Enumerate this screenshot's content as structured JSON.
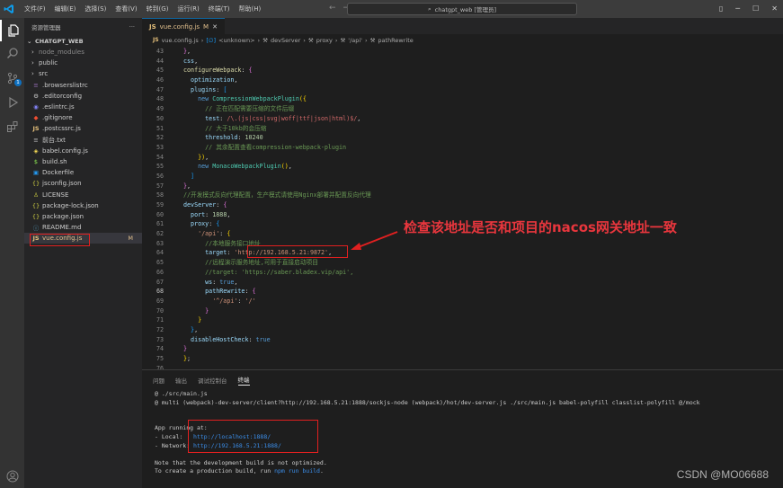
{
  "titlebar": {
    "menu": [
      "文件(F)",
      "编辑(E)",
      "选择(S)",
      "查看(V)",
      "转到(G)",
      "运行(R)",
      "终端(T)",
      "帮助(H)"
    ],
    "search_text": "chatgpt_web [管理员]"
  },
  "activity": {
    "icons": [
      "explorer-icon",
      "search-icon",
      "source-control-icon",
      "run-debug-icon",
      "extensions-icon",
      "account-icon"
    ],
    "scm_badge": "1"
  },
  "sidebar": {
    "header": "资源管理器",
    "project": "CHATGPT_WEB",
    "items": [
      {
        "label": "node_modules",
        "type": "folder"
      },
      {
        "label": "public",
        "type": "folder"
      },
      {
        "label": "src",
        "type": "folder"
      },
      {
        "label": ".browserslistrc",
        "type": "file"
      },
      {
        "label": ".editorconfig",
        "type": "file"
      },
      {
        "label": ".eslintrc.js",
        "type": "file"
      },
      {
        "label": ".gitignore",
        "type": "file"
      },
      {
        "label": ".postcssrc.js",
        "type": "file"
      },
      {
        "label": "前台.txt",
        "type": "file"
      },
      {
        "label": "babel.config.js",
        "type": "file"
      },
      {
        "label": "build.sh",
        "type": "file"
      },
      {
        "label": "Dockerfile",
        "type": "file"
      },
      {
        "label": "jsconfig.json",
        "type": "file"
      },
      {
        "label": "LICENSE",
        "type": "file"
      },
      {
        "label": "package-lock.json",
        "type": "file"
      },
      {
        "label": "package.json",
        "type": "file"
      },
      {
        "label": "README.md",
        "type": "file"
      },
      {
        "label": "vue.config.js",
        "type": "file",
        "status": "M"
      }
    ]
  },
  "editor": {
    "tab_label": "vue.config.js",
    "tab_status": "M",
    "breadcrumb": [
      "vue.config.js",
      "<unknown>",
      "devServer",
      "proxy",
      "'/api'",
      "pathRewrite"
    ],
    "line_numbers": [
      "43",
      "44",
      "45",
      "46",
      "47",
      "48",
      "49",
      "50",
      "51",
      "52",
      "53",
      "54",
      "55",
      "56",
      "57",
      "58",
      "59",
      "60",
      "61",
      "62",
      "63",
      "64",
      "65",
      "66",
      "67",
      "68",
      "69",
      "70",
      "71",
      "72",
      "73",
      "74",
      "75",
      "76"
    ],
    "current_line": "68"
  },
  "annotation": {
    "text": "检查该地址是否和项目的nacos网关地址一致"
  },
  "panel": {
    "tabs": [
      "问题",
      "输出",
      "调试控制台",
      "终端"
    ],
    "active_tab": "终端",
    "terminal": {
      "line1": "@ ./src/main.js",
      "line2": "@ multi (webpack)-dev-server/client?http://192.168.5.21:1888/sockjs-node (webpack)/hot/dev-server.js ./src/main.js babel-polyfill classlist-polyfill @/mock",
      "running": "App running at:",
      "local_label": "- Local:   ",
      "local_url": "http://localhost:1888/",
      "network_label": "- Network: ",
      "network_url": "http://192.168.5.21:1888/",
      "note1": "Note that the development build is not optimized.",
      "note2_prefix": "To create a production build, run ",
      "note2_cmd": "npm run build",
      "note2_suffix": "."
    }
  },
  "watermark": "CSDN @MO06688",
  "colors": {
    "annotation_red": "#e8363d",
    "box_red": "#e02020",
    "modified": "#e2c08d"
  }
}
